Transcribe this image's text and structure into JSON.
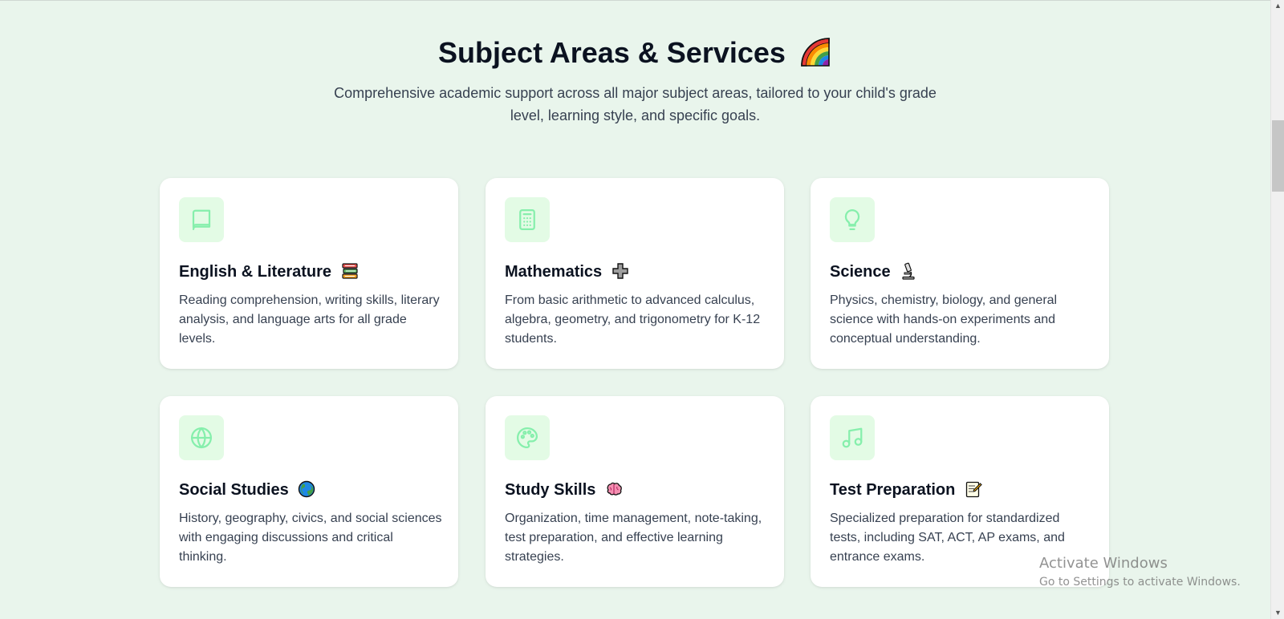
{
  "section": {
    "title": "Subject Areas & Services",
    "title_emoji": "rainbow-emoji",
    "subtitle": "Comprehensive academic support across all major subject areas, tailored to your child's grade level, learning style, and specific goals."
  },
  "theme": {
    "page_background": "#e9f5ec",
    "icon_tile_background": "#e3fbe5",
    "icon_stroke": "#86efac",
    "card_background": "#ffffff"
  },
  "cards": [
    {
      "title": "English & Literature",
      "icon": "book-icon",
      "emoji": "books-emoji",
      "description": "Reading comprehension, writing skills, literary analysis, and language arts for all grade levels."
    },
    {
      "title": "Mathematics",
      "icon": "calculator-icon",
      "emoji": "plus-emoji",
      "description": "From basic arithmetic to advanced calculus, algebra, geometry, and trigonometry for K-12 students."
    },
    {
      "title": "Science",
      "icon": "lightbulb-icon",
      "emoji": "microscope-emoji",
      "description": "Physics, chemistry, biology, and general science with hands-on experiments and conceptual understanding."
    },
    {
      "title": "Social Studies",
      "icon": "globe-icon",
      "emoji": "earth-emoji",
      "description": "History, geography, civics, and social sciences with engaging discussions and critical thinking."
    },
    {
      "title": "Study Skills",
      "icon": "palette-icon",
      "emoji": "brain-emoji",
      "description": "Organization, time management, note-taking, test preparation, and effective learning strategies."
    },
    {
      "title": "Test Preparation",
      "icon": "music-note-icon",
      "emoji": "memo-emoji",
      "description": "Specialized preparation for standardized tests, including SAT, ACT, AP exams, and entrance exams."
    }
  ],
  "os_watermark": {
    "title": "Activate Windows",
    "subtitle": "Go to Settings to activate Windows."
  }
}
